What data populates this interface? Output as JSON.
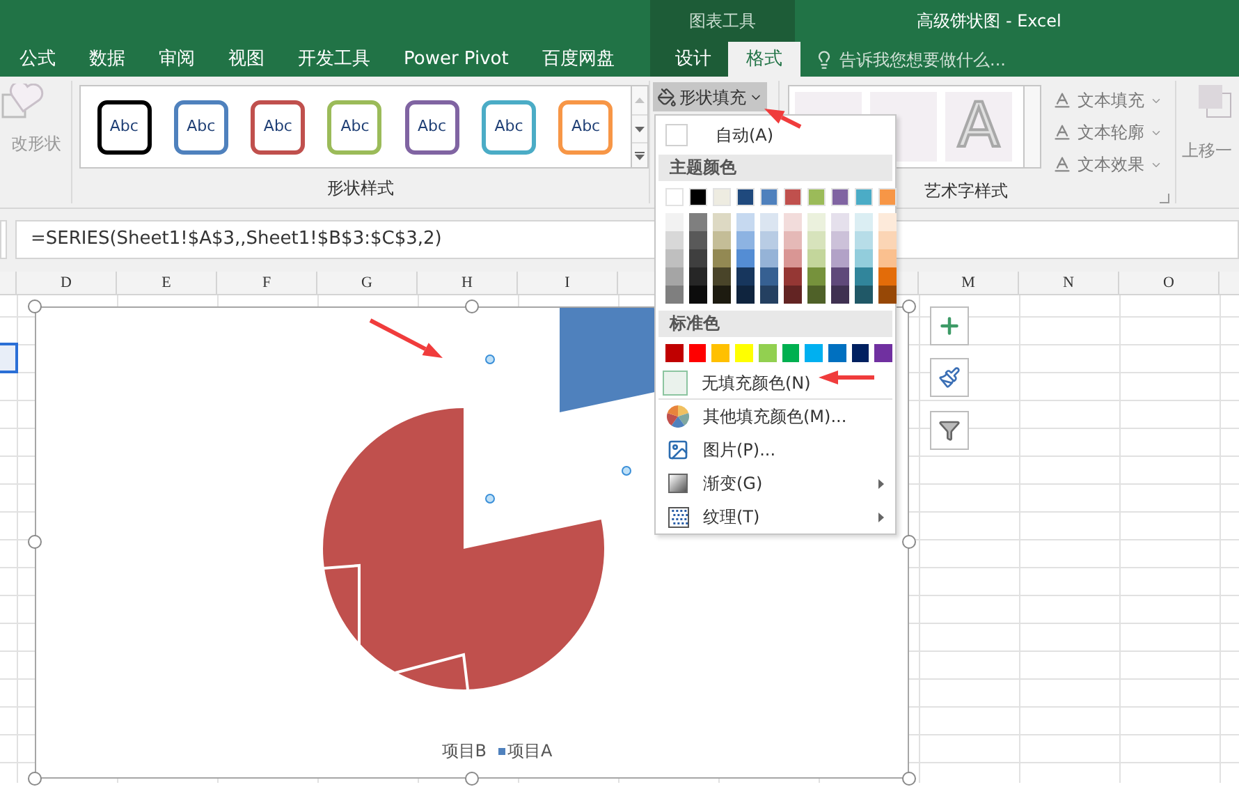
{
  "title_bar": {
    "context_group": "图表工具",
    "title": "高级饼状图 - Excel"
  },
  "ribbon_tabs": [
    {
      "label": "公式",
      "selected": false
    },
    {
      "label": "数据",
      "selected": false
    },
    {
      "label": "审阅",
      "selected": false
    },
    {
      "label": "视图",
      "selected": false
    },
    {
      "label": "开发工具",
      "selected": false
    },
    {
      "label": "Power Pivot",
      "selected": false
    },
    {
      "label": "百度网盘",
      "selected": false
    }
  ],
  "context_tabs": [
    {
      "label": "设计",
      "selected": false
    },
    {
      "label": "格式",
      "selected": true
    }
  ],
  "tell_me": {
    "placeholder": "告诉我您想要做什么..."
  },
  "ribbon": {
    "change_shape": {
      "label": "改形状",
      "disabled": true
    },
    "shape_styles": {
      "group_label": "形状样式",
      "items": [
        {
          "label": "Abc",
          "color": "#000000"
        },
        {
          "label": "Abc",
          "color": "#4f81bd"
        },
        {
          "label": "Abc",
          "color": "#c0504d"
        },
        {
          "label": "Abc",
          "color": "#9bbb59"
        },
        {
          "label": "Abc",
          "color": "#8064a2"
        },
        {
          "label": "Abc",
          "color": "#4bacc6"
        },
        {
          "label": "Abc",
          "color": "#f79646"
        }
      ]
    },
    "shape_fill": {
      "label": "形状填充",
      "expanded": true
    },
    "wordart": {
      "group_label": "艺术字样式",
      "items": [
        "A"
      ],
      "buttons": [
        "文本填充",
        "文本轮廓",
        "文本效果"
      ]
    },
    "bring_forward": {
      "label": "上移一"
    }
  },
  "formula_bar": {
    "value": "=SERIES(Sheet1!$A$3,,Sheet1!$B$3:$C$3,2)"
  },
  "columns_left": [
    "D",
    "E",
    "F",
    "G",
    "H",
    "I"
  ],
  "columns_right": [
    "M",
    "N",
    "O"
  ],
  "chart": {
    "legend": [
      {
        "label": "项目B"
      },
      {
        "label": "项目A",
        "color": "#4f81bd"
      }
    ]
  },
  "fill_menu": {
    "auto": "自动(A)",
    "theme_heading": "主题颜色",
    "theme_colors": [
      {
        "color": "#ffffff",
        "shades": [
          {
            "color": "#f2f2f2"
          },
          {
            "color": "#d8d8d8"
          },
          {
            "color": "#bfbfbf"
          },
          {
            "color": "#a5a5a5"
          },
          {
            "color": "#7f7f7f"
          }
        ]
      },
      {
        "color": "#000000",
        "shades": [
          {
            "color": "#7f7f7f"
          },
          {
            "color": "#595959"
          },
          {
            "color": "#3f3f3f"
          },
          {
            "color": "#262626"
          },
          {
            "color": "#0c0c0c"
          }
        ]
      },
      {
        "color": "#eeece1",
        "shades": [
          {
            "color": "#ddd9c3"
          },
          {
            "color": "#c4bd97"
          },
          {
            "color": "#938953"
          },
          {
            "color": "#494429"
          },
          {
            "color": "#1d1b10"
          }
        ]
      },
      {
        "color": "#1f497d",
        "shades": [
          {
            "color": "#c6d9f0"
          },
          {
            "color": "#8db3e2"
          },
          {
            "color": "#548dd4"
          },
          {
            "color": "#17365d"
          },
          {
            "color": "#0f243e"
          }
        ]
      },
      {
        "color": "#4f81bd",
        "shades": [
          {
            "color": "#dbe5f1"
          },
          {
            "color": "#b8cce4"
          },
          {
            "color": "#95b3d7"
          },
          {
            "color": "#366092"
          },
          {
            "color": "#244061"
          }
        ]
      },
      {
        "color": "#c0504d",
        "shades": [
          {
            "color": "#f2dcdb"
          },
          {
            "color": "#e5b9b7"
          },
          {
            "color": "#d99694"
          },
          {
            "color": "#953734"
          },
          {
            "color": "#632423"
          }
        ]
      },
      {
        "color": "#9bbb59",
        "shades": [
          {
            "color": "#ebf1dd"
          },
          {
            "color": "#d7e3bc"
          },
          {
            "color": "#c3d69b"
          },
          {
            "color": "#76923c"
          },
          {
            "color": "#4f6128"
          }
        ]
      },
      {
        "color": "#8064a2",
        "shades": [
          {
            "color": "#e5e0ec"
          },
          {
            "color": "#ccc1d9"
          },
          {
            "color": "#b2a2c7"
          },
          {
            "color": "#5f497a"
          },
          {
            "color": "#3f3151"
          }
        ]
      },
      {
        "color": "#4bacc6",
        "shades": [
          {
            "color": "#dbeef3"
          },
          {
            "color": "#b7dde8"
          },
          {
            "color": "#92cddc"
          },
          {
            "color": "#31859b"
          },
          {
            "color": "#205867"
          }
        ]
      },
      {
        "color": "#f79646",
        "shades": [
          {
            "color": "#fdeada"
          },
          {
            "color": "#fbd5b5"
          },
          {
            "color": "#fac08f"
          },
          {
            "color": "#e36c09"
          },
          {
            "color": "#974806"
          }
        ]
      }
    ],
    "standard_heading": "标准色",
    "standard_colors": [
      {
        "color": "#c00000"
      },
      {
        "color": "#ff0000"
      },
      {
        "color": "#ffc000"
      },
      {
        "color": "#ffff00"
      },
      {
        "color": "#92d050"
      },
      {
        "color": "#00b050"
      },
      {
        "color": "#00b0f0"
      },
      {
        "color": "#0070c0"
      },
      {
        "color": "#002060"
      },
      {
        "color": "#7030a0"
      }
    ],
    "no_fill": "无填充颜色(N)",
    "items": [
      {
        "label": "其他填充颜色(M)...",
        "kind": "palette",
        "submenu": false
      },
      {
        "label": "图片(P)...",
        "kind": "picture",
        "submenu": false
      },
      {
        "label": "渐变(G)",
        "kind": "gradient",
        "submenu": true
      },
      {
        "label": "纹理(T)",
        "kind": "texture",
        "submenu": true
      }
    ]
  }
}
